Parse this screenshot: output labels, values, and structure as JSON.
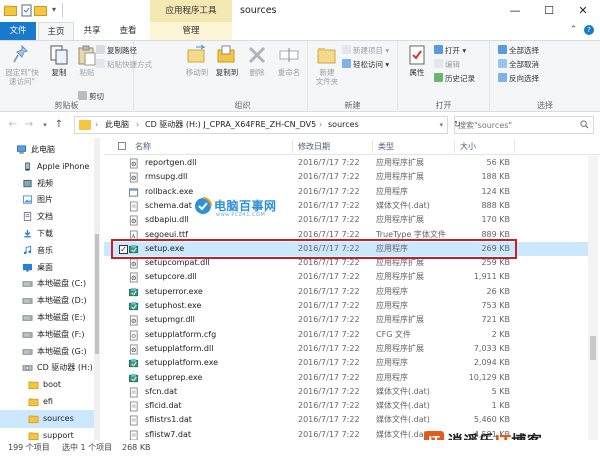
{
  "window": {
    "title": "sources",
    "context_tab_title": "应用程序工具",
    "minimize": "—",
    "maximize": "☐",
    "close": "✕"
  },
  "tabs": {
    "file": "文件",
    "home": "主页",
    "share": "共享",
    "view": "查看",
    "manage": "管理"
  },
  "ribbon": {
    "clipboard": {
      "label": "剪贴板",
      "pin": "固定到\"快\n速访问\"",
      "copy": "复制",
      "paste": "粘贴",
      "cut": "剪切",
      "copy_path": "复制路径",
      "paste_shortcut": "粘贴快捷方式"
    },
    "organize": {
      "label": "组织",
      "move_to": "移动到",
      "copy_to": "复制到",
      "delete": "删除",
      "rename": "重命名"
    },
    "new": {
      "label": "新建",
      "new_folder": "新建\n文件夹",
      "new_item": "新建项目",
      "easy_access": "轻松访问"
    },
    "open": {
      "label": "打开",
      "properties": "属性",
      "open": "打开",
      "edit": "编辑",
      "history": "历史记录"
    },
    "select": {
      "label": "选择",
      "select_all": "全部选择",
      "select_none": "全部取消",
      "invert": "反向选择"
    }
  },
  "address": {
    "crumbs": [
      "此电脑",
      "CD 驱动器 (H:) J_CPRA_X64FRE_ZH-CN_DV5",
      "sources"
    ],
    "search_placeholder": "搜索\"sources\""
  },
  "nav": {
    "items": [
      {
        "label": "此电脑",
        "icon": "pc-icon",
        "selected": false
      },
      {
        "label": "Apple iPhone",
        "icon": "phone-icon",
        "selected": false
      },
      {
        "label": "视频",
        "icon": "video-icon",
        "selected": false
      },
      {
        "label": "图片",
        "icon": "pictures-icon",
        "selected": false
      },
      {
        "label": "文档",
        "icon": "documents-icon",
        "selected": false
      },
      {
        "label": "下载",
        "icon": "download-icon",
        "selected": false
      },
      {
        "label": "音乐",
        "icon": "music-icon",
        "selected": false
      },
      {
        "label": "桌面",
        "icon": "desktop-icon",
        "selected": false
      },
      {
        "label": "本地磁盘 (C:)",
        "icon": "drive-icon",
        "selected": false
      },
      {
        "label": "本地磁盘 (D:)",
        "icon": "drive-icon",
        "selected": false
      },
      {
        "label": "本地磁盘 (E:)",
        "icon": "drive-icon",
        "selected": false
      },
      {
        "label": "本地磁盘 (F:)",
        "icon": "drive-icon",
        "selected": false
      },
      {
        "label": "本地磁盘 (G:)",
        "icon": "drive-icon",
        "selected": false
      },
      {
        "label": "CD 驱动器 (H:)",
        "icon": "cd-drive-icon",
        "selected": false
      },
      {
        "label": "boot",
        "icon": "folder-icon",
        "selected": false
      },
      {
        "label": "efi",
        "icon": "folder-icon",
        "selected": false
      },
      {
        "label": "sources",
        "icon": "folder-icon",
        "selected": true
      },
      {
        "label": "support",
        "icon": "folder-icon",
        "selected": false
      }
    ]
  },
  "columns": {
    "name": "名称",
    "date": "修改日期",
    "type": "类型",
    "size": "大小"
  },
  "files": [
    {
      "name": "reportgen.dll",
      "date": "2016/7/17 7:22",
      "type": "应用程序扩展",
      "size": "56 KB",
      "icon": "dll-icon",
      "selected": false
    },
    {
      "name": "rmsupg.dll",
      "date": "2016/7/17 7:22",
      "type": "应用程序扩展",
      "size": "188 KB",
      "icon": "dll-icon",
      "selected": false
    },
    {
      "name": "rollback.exe",
      "date": "2016/7/17 7:22",
      "type": "应用程序",
      "size": "124 KB",
      "icon": "exe-icon",
      "selected": false
    },
    {
      "name": "schema.dat",
      "date": "2016/7/17 7:22",
      "type": "媒体文件(.dat)",
      "size": "888 KB",
      "icon": "dat-icon",
      "selected": false
    },
    {
      "name": "sdbapiu.dll",
      "date": "2016/7/17 7:22",
      "type": "应用程序扩展",
      "size": "170 KB",
      "icon": "dll-icon",
      "selected": false
    },
    {
      "name": "segoeui.ttf",
      "date": "2016/7/17 7:22",
      "type": "TrueType 字体文件",
      "size": "889 KB",
      "icon": "font-icon",
      "selected": false
    },
    {
      "name": "setup.exe",
      "date": "2016/7/17 7:22",
      "type": "应用程序",
      "size": "269 KB",
      "icon": "setup-icon",
      "selected": true
    },
    {
      "name": "setupcompat.dll",
      "date": "2016/7/17 7:22",
      "type": "应用程序扩展",
      "size": "259 KB",
      "icon": "dll-icon",
      "selected": false
    },
    {
      "name": "setupcore.dll",
      "date": "2016/7/17 7:22",
      "type": "应用程序扩展",
      "size": "1,911 KB",
      "icon": "dll-icon",
      "selected": false
    },
    {
      "name": "setuperror.exe",
      "date": "2016/7/17 7:22",
      "type": "应用程序",
      "size": "26 KB",
      "icon": "setup-icon",
      "selected": false
    },
    {
      "name": "setuphost.exe",
      "date": "2016/7/17 7:22",
      "type": "应用程序",
      "size": "753 KB",
      "icon": "setup-icon",
      "selected": false
    },
    {
      "name": "setupmgr.dll",
      "date": "2016/7/17 7:22",
      "type": "应用程序扩展",
      "size": "721 KB",
      "icon": "dll-icon",
      "selected": false
    },
    {
      "name": "setupplatform.cfg",
      "date": "2016/7/17 7:22",
      "type": "CFG 文件",
      "size": "2 KB",
      "icon": "cfg-icon",
      "selected": false
    },
    {
      "name": "setupplatform.dll",
      "date": "2016/7/17 7:22",
      "type": "应用程序扩展",
      "size": "7,033 KB",
      "icon": "dll-icon",
      "selected": false
    },
    {
      "name": "setupplatform.exe",
      "date": "2016/7/17 7:22",
      "type": "应用程序",
      "size": "2,094 KB",
      "icon": "setup-icon",
      "selected": false
    },
    {
      "name": "setupprep.exe",
      "date": "2016/7/17 7:22",
      "type": "应用程序",
      "size": "10,129 KB",
      "icon": "setup-icon",
      "selected": false
    },
    {
      "name": "sfcn.dat",
      "date": "2016/7/17 7:22",
      "type": "媒体文件(.dat)",
      "size": "5 KB",
      "icon": "dat-icon",
      "selected": false
    },
    {
      "name": "sflcid.dat",
      "date": "2016/7/17 7:22",
      "type": "媒体文件(.dat)",
      "size": "1 KB",
      "icon": "dat-icon",
      "selected": false
    },
    {
      "name": "sflistrs1.dat",
      "date": "2016/7/17 7:22",
      "type": "媒体文件(.dat)",
      "size": "5,460 KB",
      "icon": "dat-icon",
      "selected": false
    },
    {
      "name": "sflistw7.dat",
      "date": "2016/7/17 7:22",
      "type": "媒体文件(.dat)",
      "size": "4,581 KB",
      "icon": "dat-icon",
      "selected": false
    }
  ],
  "status": {
    "item_count": "199 个项目",
    "selected": "选中 1 个项目",
    "selected_size": "268 KB"
  },
  "watermark": {
    "center_text": "电脑百事网",
    "center_url": "www.PC841.COM",
    "brand_badge": "IT",
    "brand_prefix": "逍遥乐",
    "brand_it": "IT",
    "brand_suffix": "博客"
  },
  "colors": {
    "accent": "#1979ca",
    "selection": "#cce8ff",
    "highlight_box": "#c2202a",
    "folder": "#f5c642",
    "context_tab": "#f5e9b3"
  }
}
